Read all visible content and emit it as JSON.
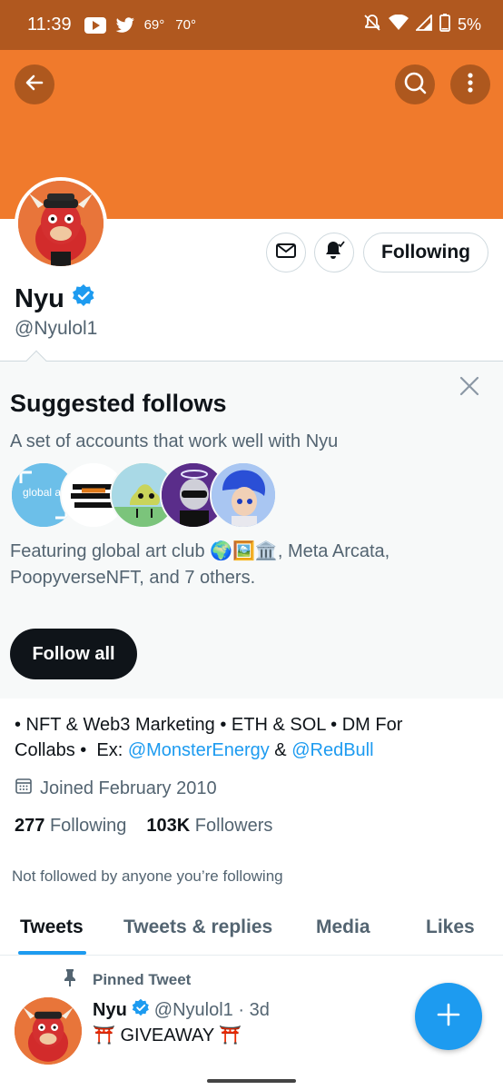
{
  "status_bar": {
    "time": "11:39",
    "temp1": "69°",
    "temp2": "70°",
    "battery": "5%",
    "icons": [
      "youtube-icon",
      "twitter-icon",
      "mute-icon",
      "wifi-icon",
      "signal-icon",
      "battery-icon"
    ]
  },
  "header": {
    "banner_color": "#f07a2c",
    "icons": [
      "back-arrow-icon",
      "search-icon",
      "more-vertical-icon"
    ]
  },
  "profile": {
    "name": "Nyu",
    "handle": "@Nyulol1",
    "verified": true,
    "following_label": "Following",
    "message_icon": "mail-icon",
    "notify_icon": "bell-checked-icon"
  },
  "suggested": {
    "title": "Suggested follows",
    "subtitle": "A set of accounts that work well with Nyu",
    "avatar_text": "global art club",
    "featuring_prefix": "Featuring global art club 🌍🖼️🏛️, Meta Arcata,",
    "featuring_rest": "PoopyverseNFT, and 7 others.",
    "follow_all_label": "Follow all"
  },
  "bio": {
    "line1": "• NFT & Web3 Marketing • ETH & SOL • DM For",
    "line2_prefix": "Collabs •  Ex: ",
    "link1": "@MonsterEnergy",
    "amp": " & ",
    "link2": "@RedBull"
  },
  "meta": {
    "joined": "Joined February 2010",
    "following_count": "277",
    "following_label": "Following",
    "followers_count": "103K",
    "followers_label": "Followers",
    "not_followed": "Not followed by anyone you’re following"
  },
  "tabs": [
    {
      "label": "Tweets",
      "active": true
    },
    {
      "label": "Tweets & replies",
      "active": false
    },
    {
      "label": "Media",
      "active": false
    },
    {
      "label": "Likes",
      "active": false
    }
  ],
  "tweet": {
    "pinned_label": "Pinned Tweet",
    "name": "Nyu",
    "handle_time": "@Nyulol1 · 3d",
    "text": "⛩️ GIVEAWAY ⛩️"
  },
  "colors": {
    "accent": "#1d9bf0",
    "banner": "#f07a2c",
    "status_bar": "#b0581f"
  }
}
